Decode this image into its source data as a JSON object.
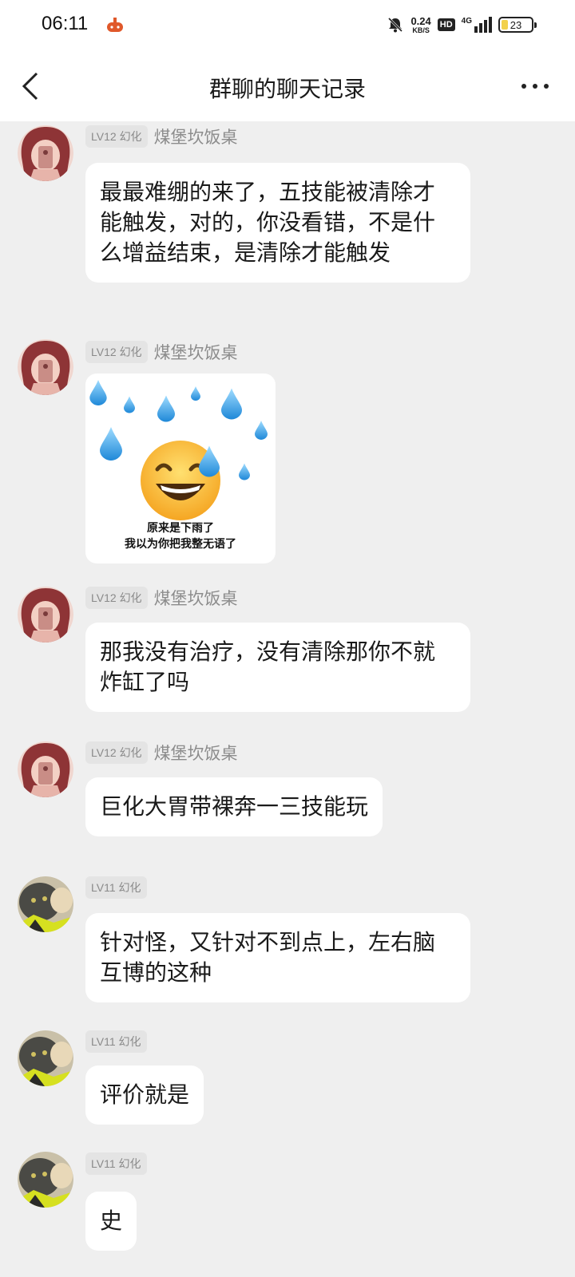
{
  "status_bar": {
    "time": "06:11",
    "net_speed_value": "0.24",
    "net_speed_unit": "KB/S",
    "hd": "HD",
    "network": "4G",
    "battery": "23",
    "battery_level": 0.23
  },
  "header": {
    "title": "群聊的聊天记录"
  },
  "messages": [
    {
      "level": "LV12",
      "title": "幻化",
      "nickname": "煤堡坎饭桌",
      "text": "最最难绷的来了，五技能被清除才能触发，对的，你没看错，不是什么增益结束，是清除才能触发"
    },
    {
      "level": "LV12",
      "title": "幻化",
      "nickname": "煤堡坎饭桌",
      "sticker_caption_line1": "原来是下雨了",
      "sticker_caption_line2": "我以为你把我整无语了"
    },
    {
      "level": "LV12",
      "title": "幻化",
      "nickname": "煤堡坎饭桌",
      "text": "那我没有治疗，没有清除那你不就炸缸了吗"
    },
    {
      "level": "LV12",
      "title": "幻化",
      "nickname": "煤堡坎饭桌",
      "text": "巨化大胃带裸奔一三技能玩"
    },
    {
      "level": "LV11",
      "title": "幻化",
      "nickname": "",
      "text": "针对怪，又针对不到点上，左右脑互博的这种"
    },
    {
      "level": "LV11",
      "title": "幻化",
      "nickname": "",
      "text": "评价就是"
    },
    {
      "level": "LV11",
      "title": "幻化",
      "nickname": "",
      "text": "史"
    }
  ]
}
